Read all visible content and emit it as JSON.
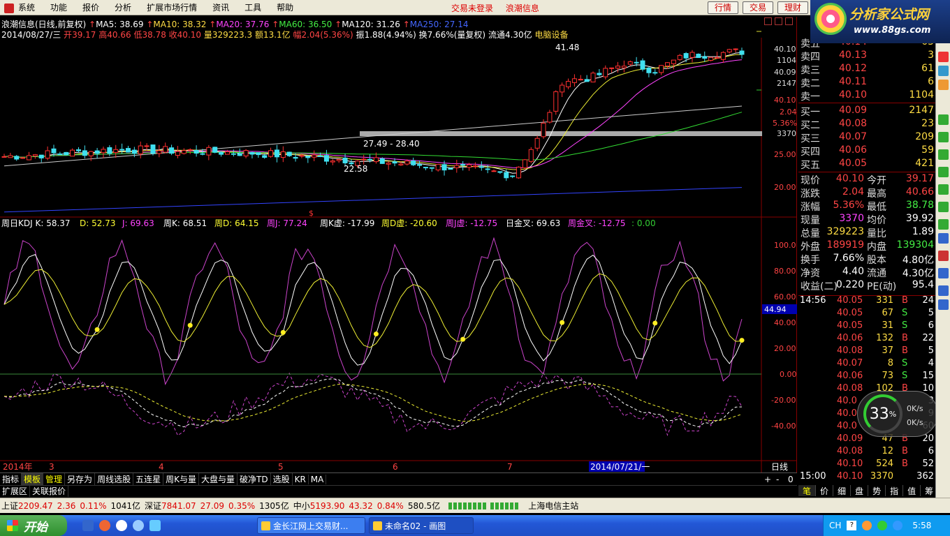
{
  "menubar": {
    "items": [
      "系统",
      "功能",
      "报价",
      "分析",
      "扩展市场行情",
      "资讯",
      "工具",
      "帮助"
    ],
    "center": [
      "交易未登录",
      "浪潮信息"
    ],
    "buttons": [
      "行情",
      "交易",
      "理财"
    ]
  },
  "logo": {
    "title": "分析家公式网",
    "url": "www.88gs.com"
  },
  "chart_header": {
    "title": "浪潮信息(日线,前复权)",
    "ma": [
      "MA5: 38.69",
      "MA10: 38.32",
      "MA20: 37.76",
      "MA60: 36.50",
      "MA120: 31.26",
      "MA250: 27.14"
    ],
    "line2": {
      "date": "2014/08/27/三",
      "open_lbl": "开",
      "open": "39.17",
      "high_lbl": "高",
      "high": "40.66",
      "low_lbl": "低",
      "low": "38.78",
      "close_lbl": "收",
      "close": "40.10",
      "vol": "量329223.3",
      "amt": "额13.1亿",
      "chg": "幅2.04(5.36%)",
      "amp": "振1.88(4.94%)",
      "turn": "换7.66%(量复权)",
      "float": "流通4.30亿",
      "sector": "电脑设备"
    }
  },
  "price_axis": [
    "40.10",
    "1104",
    "40.09",
    "2147",
    "40.10",
    "2.04",
    "5.36%",
    "3370",
    "25.00",
    "20.00"
  ],
  "price_labels": {
    "peak": "41.48",
    "low": "22.58",
    "range": "27.49 - 28.40"
  },
  "kdj_header": [
    "周日KDJ K: 58.37",
    "D: 52.73",
    "J: 69.63",
    "周K: 68.51",
    "周D: 64.15",
    "周J: 77.24",
    "周K虚: -17.99",
    "周D虚: -20.60",
    "周J虚: -12.75",
    "日金叉: 69.63",
    "周金叉: -12.75",
    ": 0.00"
  ],
  "kdj_axis": [
    "100.0",
    "80.00",
    "60.00",
    "40.00",
    "20.00",
    "0.00",
    "-20.00",
    "-40.00"
  ],
  "kdj_marker": "44.94",
  "time_axis": {
    "year": "2014年",
    "months": [
      "3",
      "4",
      "5",
      "6",
      "7"
    ],
    "date_box": "2014/07/21/一",
    "mode": "日线"
  },
  "orderbook": {
    "sell": [
      {
        "label": "卖五",
        "price": "40.14",
        "vol": "63"
      },
      {
        "label": "卖四",
        "price": "40.13",
        "vol": "3"
      },
      {
        "label": "卖三",
        "price": "40.12",
        "vol": "61"
      },
      {
        "label": "卖二",
        "price": "40.11",
        "vol": "6"
      },
      {
        "label": "卖一",
        "price": "40.10",
        "vol": "1104"
      }
    ],
    "buy": [
      {
        "label": "买一",
        "price": "40.09",
        "vol": "2147"
      },
      {
        "label": "买二",
        "price": "40.08",
        "vol": "23"
      },
      {
        "label": "买三",
        "price": "40.07",
        "vol": "209"
      },
      {
        "label": "买四",
        "price": "40.06",
        "vol": "59"
      },
      {
        "label": "买五",
        "price": "40.05",
        "vol": "421"
      }
    ]
  },
  "quote": [
    {
      "l1": "现价",
      "v1": "40.10",
      "l2": "今开",
      "v2": "39.17"
    },
    {
      "l1": "涨跌",
      "v1": "2.04",
      "l2": "最高",
      "v2": "40.66"
    },
    {
      "l1": "涨幅",
      "v1": "5.36%",
      "l2": "最低",
      "v2": "38.78"
    },
    {
      "l1": "现量",
      "v1": "3370",
      "l2": "均价",
      "v2": "39.92"
    },
    {
      "l1": "总量",
      "v1": "329223",
      "l2": "量比",
      "v2": "1.89"
    },
    {
      "l1": "外盘",
      "v1": "189919",
      "l2": "内盘",
      "v2": "139304"
    },
    {
      "l1": "换手",
      "v1": "7.66%",
      "l2": "股本",
      "v2": "4.80亿"
    },
    {
      "l1": "净资",
      "v1": "4.40",
      "l2": "流通",
      "v2": "4.30亿"
    },
    {
      "l1": "收益(二)",
      "v1": "0.220",
      "l2": "PE(动)",
      "v2": "95.4"
    }
  ],
  "ticks": [
    {
      "t": "14:56",
      "p": "40.05",
      "v": "331",
      "s": "B",
      "n": "24"
    },
    {
      "t": "",
      "p": "40.05",
      "v": "67",
      "s": "S",
      "n": "5"
    },
    {
      "t": "",
      "p": "40.05",
      "v": "31",
      "s": "S",
      "n": "6"
    },
    {
      "t": "",
      "p": "40.06",
      "v": "132",
      "s": "B",
      "n": "22"
    },
    {
      "t": "",
      "p": "40.08",
      "v": "37",
      "s": "B",
      "n": "5"
    },
    {
      "t": "",
      "p": "40.07",
      "v": "8",
      "s": "S",
      "n": "4"
    },
    {
      "t": "",
      "p": "40.06",
      "v": "73",
      "s": "S",
      "n": "15"
    },
    {
      "t": "",
      "p": "40.08",
      "v": "102",
      "s": "B",
      "n": "10"
    },
    {
      "t": "",
      "p": "40.0",
      "v": "",
      "s": "",
      "n": "3"
    },
    {
      "t": "",
      "p": "40.0",
      "v": "",
      "s": "",
      "n": "9"
    },
    {
      "t": "",
      "p": "40.0",
      "v": "",
      "s": "",
      "n": "60"
    },
    {
      "t": "",
      "p": "40.09",
      "v": "47",
      "s": "B",
      "n": "20"
    },
    {
      "t": "",
      "p": "40.08",
      "v": "12",
      "s": "B",
      "n": "6"
    },
    {
      "t": "",
      "p": "40.10",
      "v": "524",
      "s": "B",
      "n": "52"
    },
    {
      "t": "15:00",
      "p": "40.10",
      "v": "3370",
      "s": "",
      "n": "362"
    }
  ],
  "overlay": {
    "pct": "33",
    "unit": "%",
    "up": "0K/s",
    "down": "0K/s"
  },
  "bottom_tabs": [
    "指标",
    "模板",
    "管理",
    "另存为",
    "周线选股",
    "五连星",
    "周K与量",
    "大盘与量",
    "破净TD",
    "选股",
    "KR",
    "MA"
  ],
  "bottom_right": [
    "+",
    "-",
    "0"
  ],
  "expand_tabs": [
    "扩展区",
    "关联报价"
  ],
  "right_tabs": [
    "笔",
    "价",
    "细",
    "盘",
    "势",
    "指",
    "值",
    "筹"
  ],
  "status": {
    "sh_lbl": "上证",
    "sh": "2209.47",
    "sh_chg": "2.36",
    "sh_pct": "0.11%",
    "sh_amt": "1041亿",
    "sz_lbl": "深证",
    "sz": "7841.07",
    "sz_chg": "27.09",
    "sz_pct": "0.35%",
    "sz_amt": "1305亿",
    "zx_lbl": "中小",
    "zx": "5193.90",
    "zx_chg": "43.32",
    "zx_pct": "0.84%",
    "zx_amt": "580.5亿",
    "server": "上海电信主站"
  },
  "taskbar": {
    "start": "开始",
    "tasks": [
      "金长江网上交易财...",
      "未命名02 - 画图"
    ],
    "lang": "CH",
    "time": "5:58"
  },
  "chart_data": {
    "type": "candlestick+kdj",
    "price_ylim": [
      17,
      42
    ],
    "kdj_ylim": [
      -58,
      112
    ]
  }
}
